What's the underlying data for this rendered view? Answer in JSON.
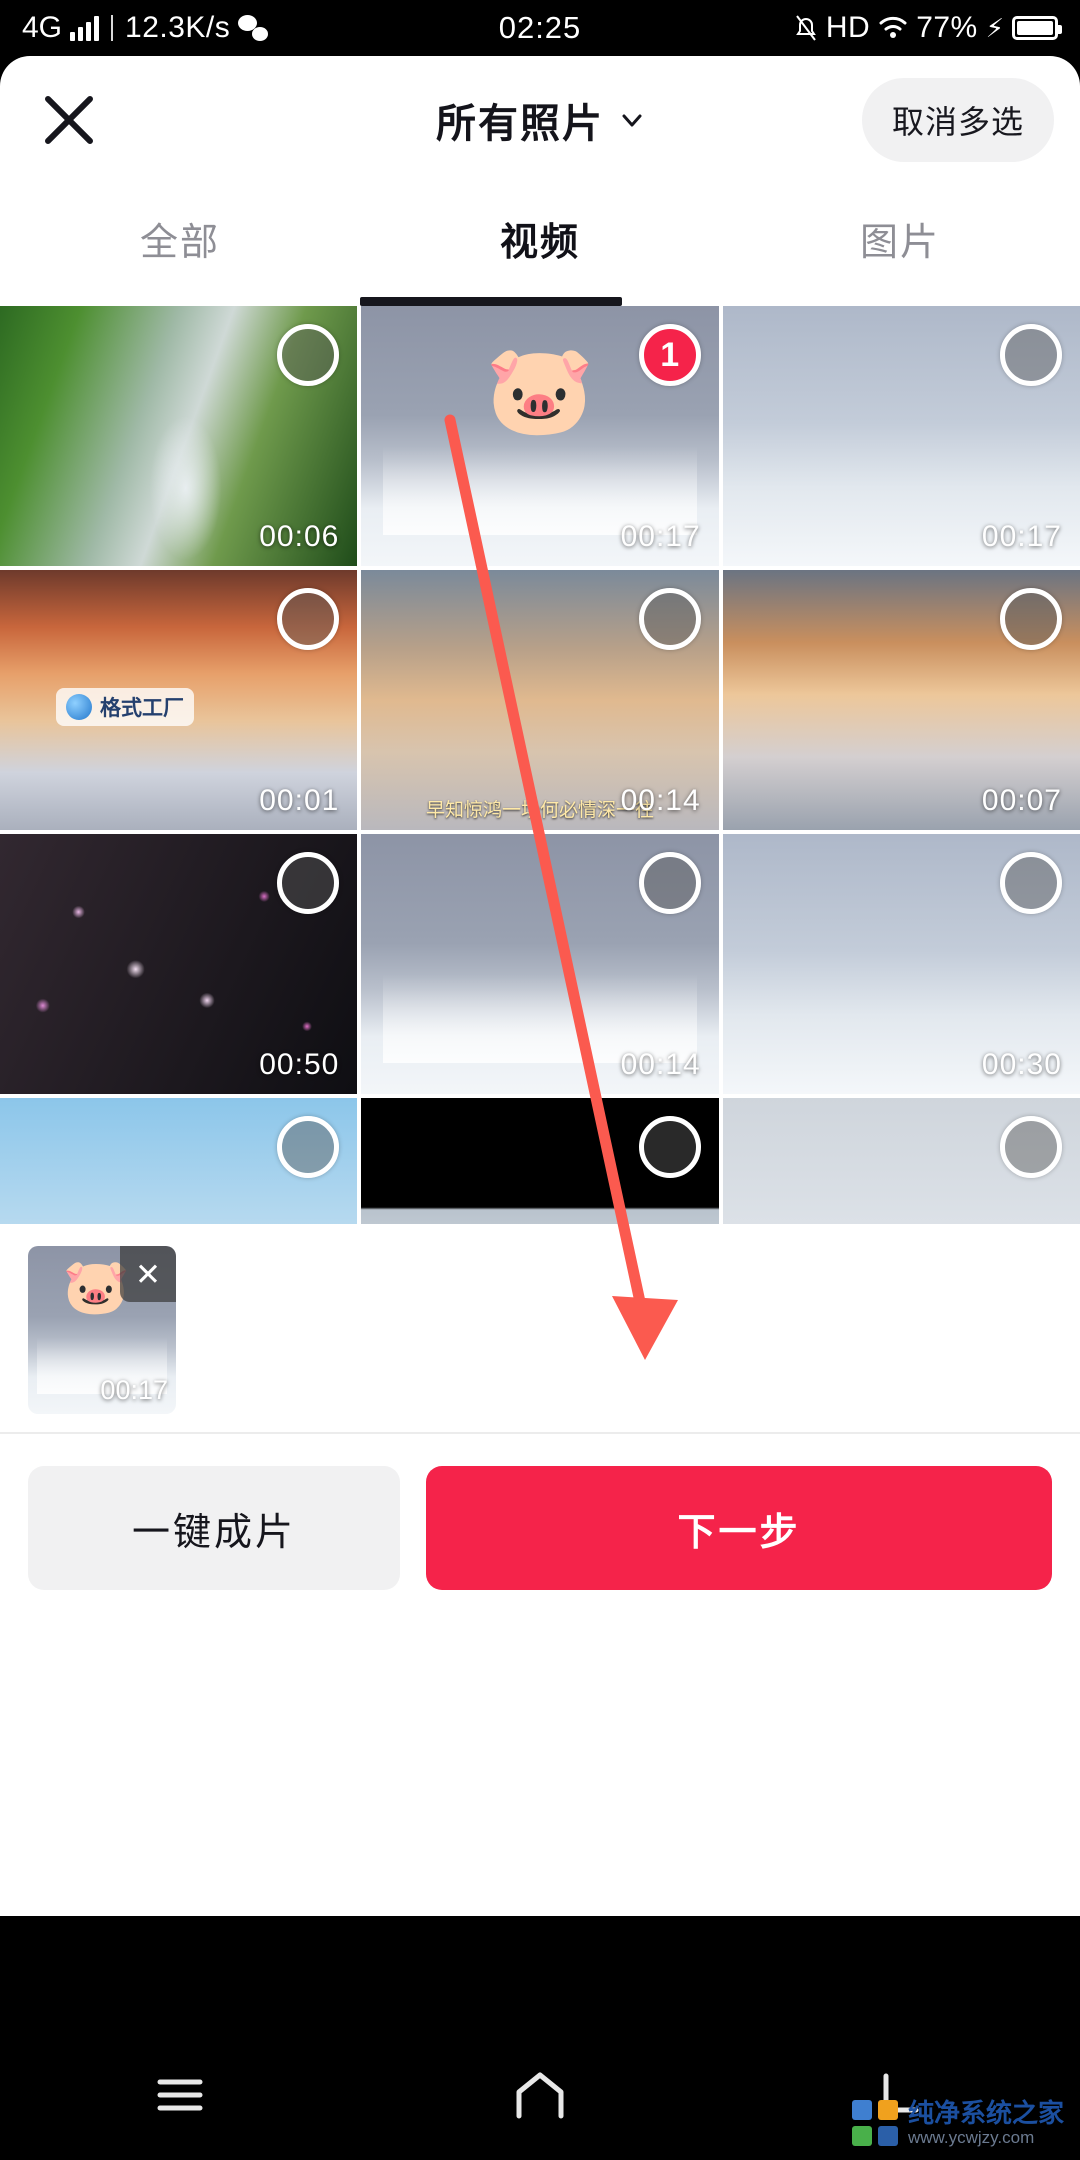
{
  "statusbar": {
    "network": "4G",
    "speed": "12.3K/s",
    "clock": "02:25",
    "hd": "HD",
    "battery": "77%",
    "wechat_icon": "wechat-icon",
    "mute_icon": "mute-icon",
    "wifi_icon": "wifi-icon",
    "charging_icon": "bolt-icon"
  },
  "header": {
    "close_icon": "close-icon",
    "title": "所有照片",
    "chevron_icon": "chevron-down-icon",
    "multiselect_label": "取消多选"
  },
  "tabs": [
    {
      "label": "全部",
      "active": false
    },
    {
      "label": "视频",
      "active": true
    },
    {
      "label": "图片",
      "active": false
    }
  ],
  "grid": {
    "items": [
      {
        "duration": "00:06",
        "selected": false,
        "badge": "",
        "sticker": "",
        "theme": "ph-waterfall",
        "overlay_text": ""
      },
      {
        "duration": "00:17",
        "selected": true,
        "badge": "1",
        "sticker": "🐷",
        "theme": "ph-snowrail",
        "overlay_text": ""
      },
      {
        "duration": "00:17",
        "selected": false,
        "badge": "",
        "sticker": "",
        "theme": "ph-snowrail2",
        "overlay_text": ""
      },
      {
        "duration": "00:01",
        "selected": false,
        "badge": "",
        "sticker": "",
        "theme": "ph-sunset",
        "overlay_text": "",
        "watermark": "格式工厂"
      },
      {
        "duration": "00:14",
        "selected": false,
        "badge": "",
        "sticker": "",
        "theme": "ph-sunset2",
        "overlay_text": "早知惊鸿一场何必情深一往"
      },
      {
        "duration": "00:07",
        "selected": false,
        "badge": "",
        "sticker": "",
        "theme": "ph-sunset3",
        "overlay_text": ""
      },
      {
        "duration": "00:50",
        "selected": false,
        "badge": "",
        "sticker": "",
        "theme": "ph-blossom",
        "overlay_text": ""
      },
      {
        "duration": "00:14",
        "selected": false,
        "badge": "",
        "sticker": "",
        "theme": "ph-snowrail",
        "overlay_text": ""
      },
      {
        "duration": "00:30",
        "selected": false,
        "badge": "",
        "sticker": "",
        "theme": "ph-snowrail2",
        "overlay_text": ""
      },
      {
        "duration": "",
        "selected": false,
        "badge": "",
        "sticker": "",
        "theme": "ph-birds",
        "overlay_text": ""
      },
      {
        "duration": "",
        "selected": false,
        "badge": "",
        "sticker": "",
        "theme": "ph-snowsmall",
        "overlay_text": ""
      },
      {
        "duration": "",
        "selected": false,
        "badge": "",
        "sticker": "",
        "theme": "ph-fog",
        "overlay_text": ""
      }
    ]
  },
  "tray": {
    "item": {
      "duration": "00:17",
      "sticker": "🐷",
      "remove_label": "✕"
    }
  },
  "actions": {
    "secondary_label": "一键成片",
    "primary_label": "下一步"
  },
  "navbar": {
    "menu_icon": "menu-icon",
    "home_icon": "home-icon",
    "back_icon": "back-icon"
  },
  "watermark": {
    "name": "纯净系统之家",
    "url": "www.ycwjzy.com"
  },
  "colors": {
    "accent_red": "#f5234a",
    "tab_active": "#16161d",
    "tab_inactive": "#8e8e95",
    "pill_bg": "#f1f1f2",
    "arrow": "#fb5a4f"
  }
}
